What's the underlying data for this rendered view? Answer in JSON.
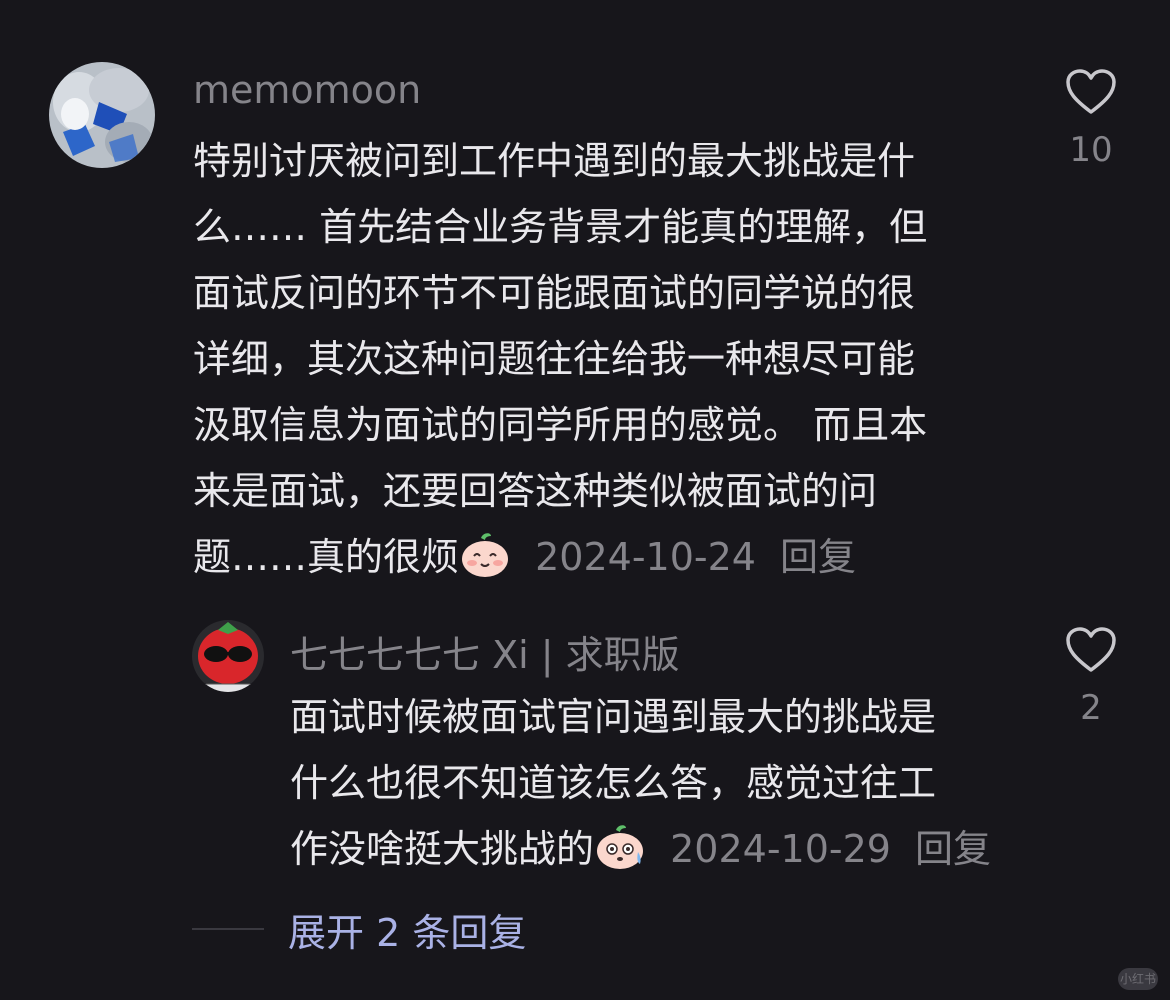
{
  "comment": {
    "username": "memomoon",
    "lines": [
      "特别讨厌被问到工作中遇到的最大挑战是什",
      "么…… 首先结合业务背景才能真的理解，但",
      "面试反问的环节不可能跟面试的同学说的很",
      "详细，其次这种问题往往给我一种想尽可能",
      "汲取信息为面试的同学所用的感觉。 而且本",
      "来是面试，还要回答这种类似被面试的问"
    ],
    "last_line": "题……真的很烦",
    "emoji": "smiling-peach-emoji",
    "date": "2024-10-24",
    "reply_label": "回复",
    "like_count": "10"
  },
  "reply": {
    "username": "七七七七七 Xi | 求职版",
    "lines": [
      "面试时候被面试官问遇到最大的挑战是",
      "什么也很不知道该怎么答，感觉过往工"
    ],
    "last_line": "作没啥挺大挑战的",
    "emoji": "sweating-peach-emoji",
    "date": "2024-10-29",
    "reply_label": "回复",
    "like_count": "2"
  },
  "expand_label": "展开 2 条回复",
  "watermark": "小红书",
  "colors": {
    "background": "#17161b",
    "text": "#e9e8ec",
    "muted": "#85848a",
    "link": "#aab2e6"
  }
}
